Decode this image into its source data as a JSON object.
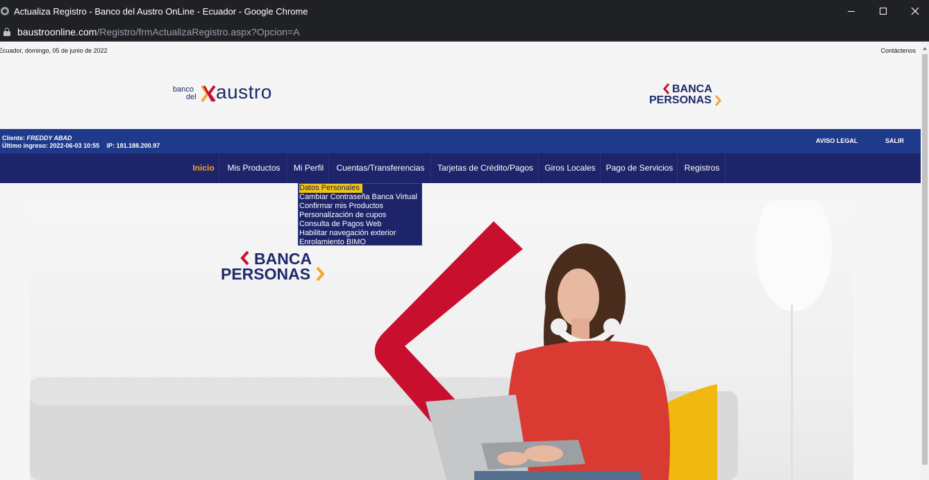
{
  "window": {
    "title": "Actualiza Registro - Banco del Austro OnLine - Ecuador - Google Chrome",
    "url_host": "baustroonline.com",
    "url_path": "/Registro/frmActualizaRegistro.aspx?Opcion=A"
  },
  "header": {
    "date": "Ecuador, domingo, 05 de junio de 2022",
    "contact": "Contáctenos",
    "logo_small_1": "banco",
    "logo_small_2": "del",
    "logo_word": "austro",
    "banca_line1": "BANCA",
    "banca_line2": "PERSONAS"
  },
  "infobar": {
    "client_label": "Cliente:",
    "client_name": "FREDDY ABAD",
    "last_login_label": "Último ingreso:",
    "last_login": "2022-06-03 10:55",
    "ip_label": "IP:",
    "ip": "181.188.200.97",
    "legal": "AVISO LEGAL",
    "logout": "SALIR"
  },
  "nav": {
    "items": [
      {
        "label": "Inicio"
      },
      {
        "label": "Mis Productos"
      },
      {
        "label": "Mi Perfil"
      },
      {
        "label": "Cuentas/Transferencias"
      },
      {
        "label": "Tarjetas de Crédito/Pagos"
      },
      {
        "label": "Giros Locales"
      },
      {
        "label": "Pago de Servicios"
      },
      {
        "label": "Registros"
      }
    ]
  },
  "dropdown": {
    "items": [
      {
        "label": "Datos Personales"
      },
      {
        "label": "Cambiar Contraseña Banca Virtual"
      },
      {
        "label": "Confirmar mis Productos"
      },
      {
        "label": "Personalización de cupos"
      },
      {
        "label": "Consulta de Pagos Web"
      },
      {
        "label": "Habilitar navegación exterior"
      },
      {
        "label": "Enrolamiento BIMO"
      }
    ]
  },
  "hero": {
    "banca_line1": "BANCA",
    "banca_line2": "PERSONAS"
  },
  "colors": {
    "brand_navy": "#1d246a",
    "brand_blue": "#1e3a8a",
    "brand_red": "#c8102e",
    "brand_yellow": "#f3a531",
    "highlight": "#f1c40f"
  }
}
